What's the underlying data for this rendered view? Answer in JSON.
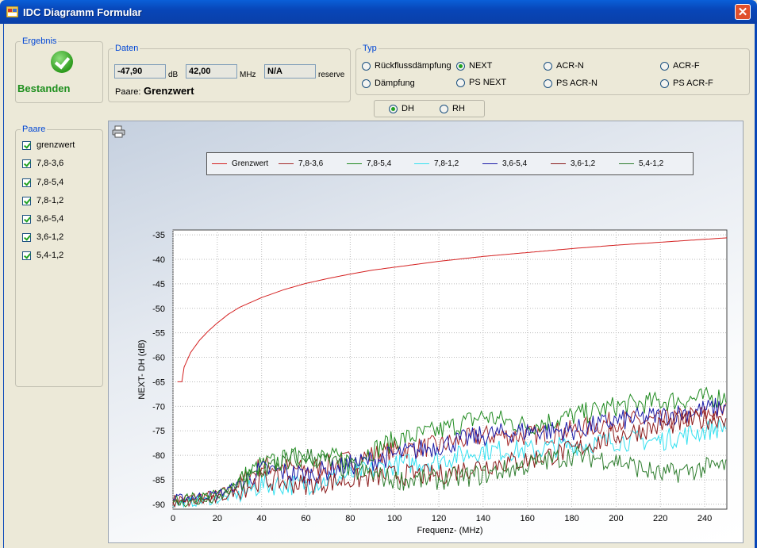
{
  "window": {
    "title": "IDC Diagramm Formular",
    "close_glyph": "✕"
  },
  "ergebnis": {
    "legend": "Ergebnis",
    "status": "Bestanden"
  },
  "daten": {
    "legend": "Daten",
    "value_db": "-47,90",
    "unit_db": "dB",
    "value_mhz": "42,00",
    "unit_mhz": "MHz",
    "reserve_value": "N/A",
    "reserve_label": "reserve",
    "paare_label": "Paare:",
    "paare_value": "Grenzwert"
  },
  "typ": {
    "legend": "Typ",
    "options": [
      {
        "label": "Rückflussdämpfung",
        "selected": false
      },
      {
        "label": "NEXT",
        "selected": true
      },
      {
        "label": "ACR-N",
        "selected": false
      },
      {
        "label": "ACR-F",
        "selected": false
      },
      {
        "label": "Dämpfung",
        "selected": false
      },
      {
        "label": "PS NEXT",
        "selected": false
      },
      {
        "label": "PS ACR-N",
        "selected": false
      },
      {
        "label": "PS ACR-F",
        "selected": false
      }
    ]
  },
  "mode": {
    "options": [
      {
        "label": "DH",
        "selected": true
      },
      {
        "label": "RH",
        "selected": false
      }
    ]
  },
  "paare": {
    "legend": "Paare",
    "items": [
      {
        "label": "grenzwert",
        "checked": true
      },
      {
        "label": "7,8-3,6",
        "checked": true
      },
      {
        "label": "7,8-5,4",
        "checked": true
      },
      {
        "label": "7,8-1,2",
        "checked": true
      },
      {
        "label": "3,6-5,4",
        "checked": true
      },
      {
        "label": "3,6-1,2",
        "checked": true
      },
      {
        "label": "5,4-1,2",
        "checked": true
      }
    ]
  },
  "icons": {
    "print": "printer-icon",
    "result": "checkmark-icon"
  },
  "chart_data": {
    "type": "line",
    "xlabel": "Frequenz- (MHz)",
    "ylabel": "NEXT- DH  (dB)",
    "xlim": [
      0,
      250
    ],
    "ylim": [
      -91,
      -34
    ],
    "xticks": [
      0,
      20,
      40,
      60,
      80,
      100,
      120,
      140,
      160,
      180,
      200,
      220,
      240
    ],
    "yticks": [
      -35,
      -40,
      -45,
      -50,
      -55,
      -60,
      -65,
      -70,
      -75,
      -80,
      -85,
      -90
    ],
    "grid": true,
    "legend_position": "top",
    "series": [
      {
        "name": "Grenzwert",
        "color": "#d42020",
        "x": [
          2,
          4,
          5,
          8,
          12,
          16,
          20,
          25,
          30,
          40,
          50,
          60,
          70,
          80,
          90,
          100,
          120,
          140,
          160,
          180,
          200,
          220,
          240,
          250
        ],
        "y": [
          -65,
          -65,
          -62,
          -59,
          -56.5,
          -54.6,
          -53,
          -51.2,
          -49.8,
          -47.8,
          -46.2,
          -44.9,
          -43.9,
          -43,
          -42.2,
          -41.6,
          -40.4,
          -39.4,
          -38.6,
          -37.8,
          -37.1,
          -36.5,
          -35.9,
          -35.6
        ]
      },
      {
        "name": "7,8-3,6",
        "color": "#a52a2a",
        "x": [
          0,
          20,
          30,
          40,
          60,
          80,
          100,
          120,
          140,
          160,
          180,
          200,
          220,
          250
        ],
        "y": [
          -89,
          -88,
          -86,
          -82,
          -83,
          -81,
          -79,
          -78,
          -76,
          -76,
          -75,
          -73,
          -73,
          -71
        ]
      },
      {
        "name": "7,8-5,4",
        "color": "#1f8a1f",
        "x": [
          0,
          20,
          30,
          40,
          60,
          80,
          100,
          120,
          140,
          160,
          180,
          200,
          220,
          250
        ],
        "y": [
          -89,
          -88,
          -85,
          -82,
          -80,
          -81,
          -77,
          -75,
          -72,
          -74,
          -72,
          -70,
          -69,
          -68
        ]
      },
      {
        "name": "7,8-1,2",
        "color": "#33e0f0",
        "x": [
          0,
          20,
          30,
          40,
          60,
          80,
          100,
          120,
          140,
          160,
          180,
          200,
          220,
          250
        ],
        "y": [
          -90,
          -89,
          -88,
          -86,
          -86,
          -84,
          -82,
          -81,
          -79,
          -79,
          -78,
          -77,
          -77,
          -74
        ]
      },
      {
        "name": "3,6-5,4",
        "color": "#1c1ca8",
        "x": [
          0,
          20,
          30,
          40,
          60,
          80,
          100,
          120,
          140,
          160,
          180,
          200,
          220,
          250
        ],
        "y": [
          -89,
          -88,
          -86,
          -83,
          -84,
          -82,
          -80,
          -78,
          -76,
          -75,
          -75,
          -73,
          -72,
          -70
        ]
      },
      {
        "name": "3,6-1,2",
        "color": "#8a1a1a",
        "x": [
          0,
          20,
          30,
          40,
          60,
          80,
          100,
          120,
          140,
          160,
          180,
          200,
          220,
          250
        ],
        "y": [
          -90,
          -89,
          -87,
          -85,
          -86,
          -85,
          -84,
          -84,
          -82,
          -81,
          -79,
          -76,
          -74,
          -72
        ]
      },
      {
        "name": "5,4-1,2",
        "color": "#2e7d2e",
        "x": [
          0,
          20,
          30,
          40,
          60,
          80,
          100,
          120,
          140,
          160,
          180,
          200,
          220,
          250
        ],
        "y": [
          -90,
          -89,
          -86,
          -83,
          -80,
          -83,
          -85,
          -85,
          -84,
          -82,
          -80,
          -81,
          -84,
          -82
        ]
      }
    ]
  }
}
